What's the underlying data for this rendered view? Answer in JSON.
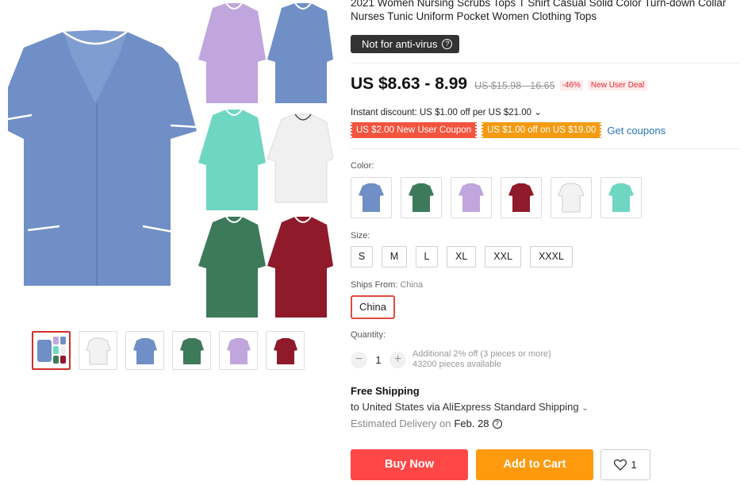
{
  "product": {
    "title": "2021 Women Nursing Scrubs Tops T Shirt Casual Solid Color Turn-down Collar Nurses Tunic Uniform Pocket Women Clothing Tops",
    "notice": "Not for anti-virus",
    "price": "US $8.63 - 8.99",
    "original_price": "US $15.98 - 16.65",
    "discount": "-46%",
    "deal_badge": "New User Deal",
    "instant_discount": "Instant discount: US $1.00 off per US $21.00 ⌄",
    "coupons": [
      "US $2.00 New User Coupon",
      "US $1.00 off on US $19.00"
    ],
    "get_coupons": "Get coupons"
  },
  "color": {
    "label": "Color:",
    "options": [
      {
        "name": "blue",
        "hex": "#6f8fc6"
      },
      {
        "name": "green",
        "hex": "#3c7a5a"
      },
      {
        "name": "lavender",
        "hex": "#c0a6dc"
      },
      {
        "name": "burgundy",
        "hex": "#8e1a2a"
      },
      {
        "name": "white",
        "hex": "#f2f2f2"
      },
      {
        "name": "aqua",
        "hex": "#6fd6c2"
      }
    ]
  },
  "size": {
    "label": "Size:",
    "options": [
      "S",
      "M",
      "L",
      "XL",
      "XXL",
      "XXXL"
    ]
  },
  "ships_from": {
    "label": "Ships From:",
    "value": "China",
    "option": "China"
  },
  "quantity": {
    "label": "Quantity:",
    "value": "1",
    "minus": "−",
    "plus": "+",
    "additional": "Additional 2% off (3 pieces or more)",
    "available": "43200 pieces available"
  },
  "shipping": {
    "title": "Free Shipping",
    "line": "to United States via AliExpress Standard Shipping",
    "delivery_label": "Estimated Delivery on",
    "delivery_date": "Feb. 28"
  },
  "actions": {
    "buy_now": "Buy Now",
    "add_to_cart": "Add to Cart",
    "wishlist_count": "1"
  },
  "colors": {
    "accent_red": "#ff4747",
    "accent_orange": "#ff9a0e",
    "link_blue": "#2a75b8"
  },
  "icons": [
    "question-icon",
    "heart-icon",
    "chevron-down-icon"
  ]
}
